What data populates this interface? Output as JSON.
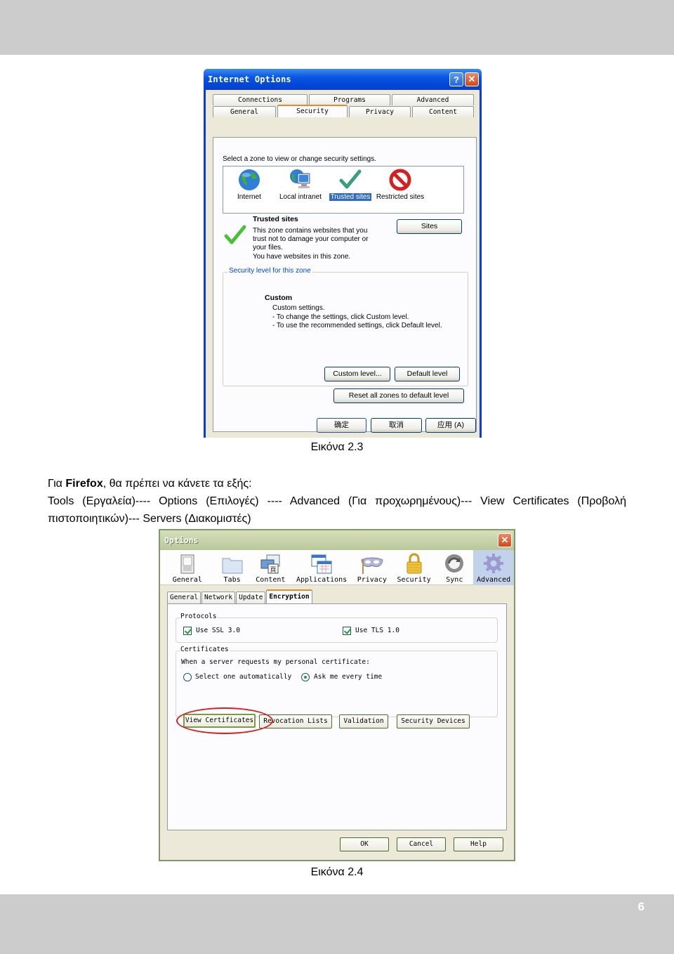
{
  "page": {
    "page_number": "6",
    "caption_1": "Εικόνα 2.3",
    "caption_2": "Εικόνα 2.4",
    "intro_prefix": "Για ",
    "intro_bold": "Firefox",
    "intro_suffix": ", θα πρέπει να κάνετε τα εξής:",
    "steps_line1": "Tools (Εργαλεία)---- Options (Επιλογές) ---- Advanced (Για προχωρημένους)--- View Certificates (Προβολή",
    "steps_line2": "πιστοποιητικών)--- Servers (Διακομιστές)"
  },
  "ie_dialog": {
    "title": "Internet Options",
    "help_button": "?",
    "close_button": "✕",
    "tabs_back": [
      "Connections",
      "Programs",
      "Advanced"
    ],
    "tabs_front": [
      "General",
      "Security",
      "Privacy",
      "Content"
    ],
    "active_tab": "Security",
    "zone_prompt": "Select a zone to view or change security settings.",
    "zones": [
      {
        "label": "Internet",
        "icon": "globe-icon"
      },
      {
        "label": "Local intranet",
        "icon": "intranet-icon"
      },
      {
        "label": "Trusted sites",
        "icon": "checkmark-icon",
        "selected": true
      },
      {
        "label": "Restricted sites",
        "icon": "restricted-icon"
      }
    ],
    "zone_title": "Trusted sites",
    "zone_desc_1": "This zone contains websites that you",
    "zone_desc_2": "trust not to damage your computer or",
    "zone_desc_3": "your files.",
    "zone_desc_4": "You have websites in this zone.",
    "sites_button": "Sites",
    "security_level_group": "Security level for this zone",
    "level_title": "Custom",
    "level_desc_1": "Custom settings.",
    "level_desc_2": "- To change the settings, click Custom level.",
    "level_desc_3": "- To use the recommended settings, click Default level.",
    "custom_level_button": "Custom level...",
    "default_level_button": "Default level",
    "reset_all_button": "Reset all zones to default level",
    "ok_button": "确定",
    "cancel_button": "取消",
    "apply_button": "应用 (A)"
  },
  "ff_dialog": {
    "title": "Options",
    "close_button": "✕",
    "panes": [
      {
        "label": "General",
        "icon": "switch-icon"
      },
      {
        "label": "Tabs",
        "icon": "folder-tabs-icon"
      },
      {
        "label": "Content",
        "icon": "content-icon"
      },
      {
        "label": "Applications",
        "icon": "applications-icon"
      },
      {
        "label": "Privacy",
        "icon": "mask-icon"
      },
      {
        "label": "Security",
        "icon": "padlock-icon"
      },
      {
        "label": "Sync",
        "icon": "sync-icon"
      },
      {
        "label": "Advanced",
        "icon": "gear-icon",
        "selected": true
      }
    ],
    "subtabs": [
      "General",
      "Network",
      "Update",
      "Encryption"
    ],
    "active_subtab": "Encryption",
    "protocols_group": "Protocols",
    "use_ssl": {
      "label": "Use SSL 3.0",
      "checked": true
    },
    "use_tls": {
      "label": "Use TLS 1.0",
      "checked": true
    },
    "certificates_group": "Certificates",
    "cert_prompt": "When a server requests my personal certificate:",
    "radio_auto": {
      "label": "Select one automatically",
      "selected": false
    },
    "radio_ask": {
      "label": "Ask me every time",
      "selected": true
    },
    "buttons": {
      "view_certificates": "View Certificates",
      "revocation_lists": "Revocation Lists",
      "validation": "Validation",
      "security_devices": "Security Devices"
    },
    "ok_button": "OK",
    "cancel_button": "Cancel",
    "help_button": "Help",
    "highlight_color": "#d62020"
  }
}
